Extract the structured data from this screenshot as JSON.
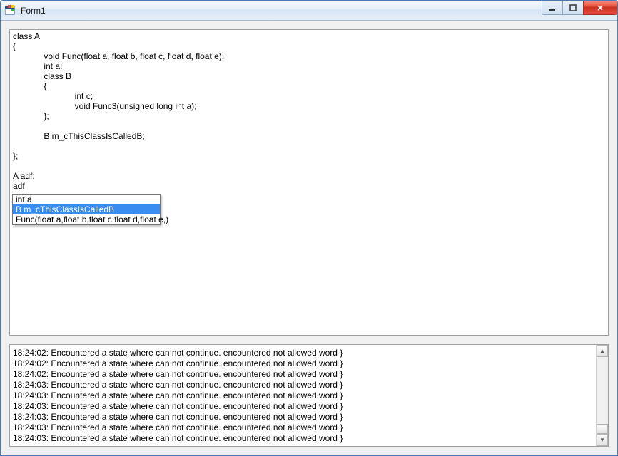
{
  "window": {
    "title": "Form1"
  },
  "code": {
    "text": "class A\n{\n             void Func(float a, float b, float c, float d, float e);\n             int a;\n             class B\n             {\n                          int c;\n                          void Func3(unsigned long int a);\n             };\n\n             B m_cThisClassIsCalledB;\n\n};\n\nA adf;\nadf"
  },
  "autocomplete": {
    "items": [
      {
        "label": "int a",
        "selected": false
      },
      {
        "label": "B m_cThisClassIsCalledB",
        "selected": true
      },
      {
        "label": "Func(float a,float b,float c,float d,float e,)",
        "selected": false
      }
    ]
  },
  "log": {
    "lines": [
      "18:24:02: Encountered a state where can not continue. encountered not allowed word }",
      "18:24:02: Encountered a state where can not continue. encountered not allowed word }",
      "18:24:02: Encountered a state where can not continue. encountered not allowed word }",
      "18:24:03: Encountered a state where can not continue. encountered not allowed word }",
      "18:24:03: Encountered a state where can not continue. encountered not allowed word }",
      "18:24:03: Encountered a state where can not continue. encountered not allowed word }",
      "18:24:03: Encountered a state where can not continue. encountered not allowed word }",
      "18:24:03: Encountered a state where can not continue. encountered not allowed word }",
      "18:24:03: Encountered a state where can not continue. encountered not allowed word }"
    ]
  }
}
